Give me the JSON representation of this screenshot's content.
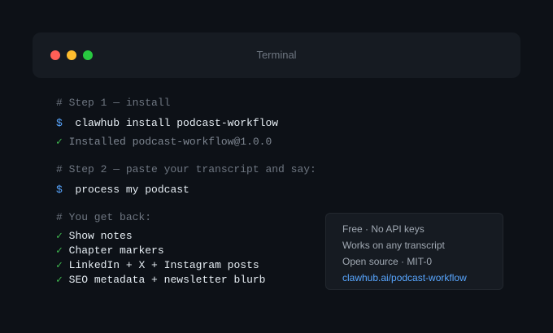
{
  "window": {
    "title": "Terminal"
  },
  "terminal": {
    "step1_comment": "# Step 1 — install",
    "prompt_symbol": "$",
    "install_command": "clawhub install podcast-workflow",
    "check_symbol": "✓",
    "install_output": "Installed podcast-workflow@1.0.0",
    "step2_comment": "# Step 2 — paste your transcript and say:",
    "process_command": "process my podcast",
    "result_comment": "# You get back:",
    "results": [
      "Show notes",
      "Chapter markers",
      "LinkedIn + X + Instagram posts",
      "SEO metadata + newsletter blurb"
    ]
  },
  "info_card": {
    "pricing": "Free · No API keys",
    "compatibility": "Works on any transcript",
    "license": "Open source · MIT-0",
    "link": "clawhub.ai/podcast-workflow"
  },
  "colors": {
    "background": "#0d1117",
    "prompt": "#58a6ff",
    "check": "#3fb950",
    "link": "#58a6ff"
  }
}
